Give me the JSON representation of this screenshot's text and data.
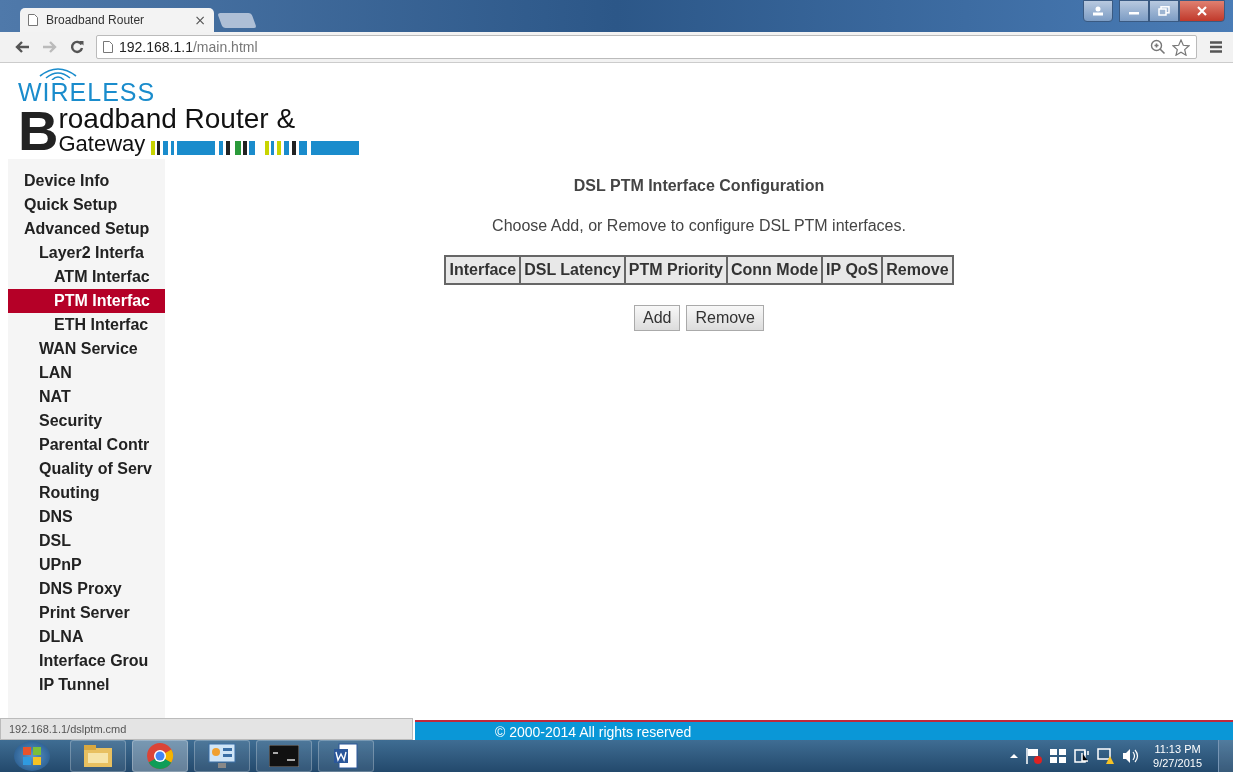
{
  "browser": {
    "tab_title": "Broadband Router",
    "tab_close": "×",
    "url_host": "192.168.1.1",
    "url_path": "/main.html",
    "status_url": "192.168.1.1/dslptm.cmd"
  },
  "logo": {
    "wireless": "WIRELESS",
    "initial": "B",
    "line1": "roadband Router &",
    "line2": "Gateway"
  },
  "sidebar": {
    "items": [
      {
        "label": "Device Info",
        "selected": false
      },
      {
        "label": "Quick Setup",
        "selected": false
      },
      {
        "label": "Advanced Setup",
        "selected": false,
        "children": [
          {
            "label": "Layer2 Interfa",
            "selected": false,
            "children": [
              {
                "label": "ATM Interfac",
                "selected": false
              },
              {
                "label": "PTM Interfac",
                "selected": true
              },
              {
                "label": "ETH Interfac",
                "selected": false
              }
            ]
          },
          {
            "label": "WAN Service",
            "selected": false
          },
          {
            "label": "LAN",
            "selected": false
          },
          {
            "label": "NAT",
            "selected": false
          },
          {
            "label": "Security",
            "selected": false
          },
          {
            "label": "Parental Contr",
            "selected": false
          },
          {
            "label": "Quality of Serv",
            "selected": false
          },
          {
            "label": "Routing",
            "selected": false
          },
          {
            "label": "DNS",
            "selected": false
          },
          {
            "label": "DSL",
            "selected": false
          },
          {
            "label": "UPnP",
            "selected": false
          },
          {
            "label": "DNS Proxy",
            "selected": false
          },
          {
            "label": "Print Server",
            "selected": false
          },
          {
            "label": "DLNA",
            "selected": false
          },
          {
            "label": "Interface Grou",
            "selected": false
          },
          {
            "label": "IP Tunnel",
            "selected": false
          }
        ]
      }
    ]
  },
  "content": {
    "title": "DSL PTM Interface Configuration",
    "description": "Choose Add, or Remove to configure DSL PTM interfaces.",
    "table": {
      "columns": [
        "Interface",
        "DSL Latency",
        "PTM Priority",
        "Conn Mode",
        "IP QoS",
        "Remove"
      ]
    },
    "buttons": [
      "Add",
      "Remove"
    ]
  },
  "footer": {
    "text": "© 2000-2014  All rights reserved"
  },
  "taskbar": {
    "time": "11:13 PM",
    "date": "9/27/2015"
  }
}
